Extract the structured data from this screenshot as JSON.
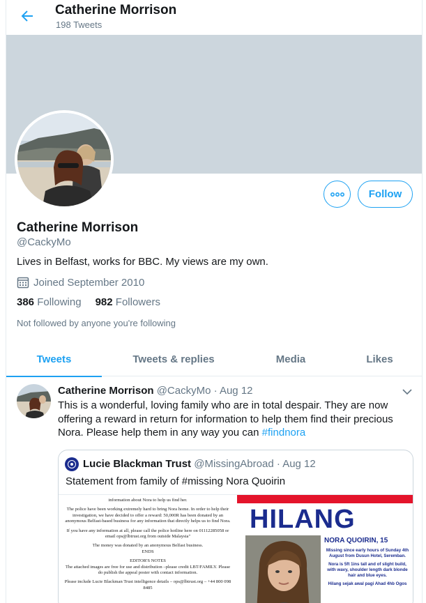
{
  "header": {
    "name": "Catherine Morrison",
    "tweet_count": "198 Tweets"
  },
  "profile": {
    "name": "Catherine Morrison",
    "handle": "@CackyMo",
    "bio": "Lives in Belfast, works for BBC. My views are my own.",
    "joined": "Joined September 2010",
    "following_count": "386",
    "following_label": "Following",
    "followers_count": "982",
    "followers_label": "Followers",
    "not_followed": "Not followed by anyone you're following",
    "follow_label": "Follow"
  },
  "tabs": [
    {
      "label": "Tweets",
      "active": true
    },
    {
      "label": "Tweets & replies",
      "active": false
    },
    {
      "label": "Media",
      "active": false
    },
    {
      "label": "Likes",
      "active": false
    }
  ],
  "tweet": {
    "author": "Catherine Morrison",
    "handle": "@CackyMo",
    "date": "· Aug 12",
    "text": "This is a wonderful, loving family who are in total despair. They are now offering a reward in return for information to help them find their precious Nora. Please help them in any way you can ",
    "hashtag": "#findnora",
    "quote": {
      "author": "Lucie Blackman Trust",
      "handle": "@MissingAbroad",
      "date": "· Aug 12",
      "text": "Statement from family of #missing Nora Quoirin",
      "document_lines": [
        "information about Nora to help us find her.",
        "The police have been working extremely hard to bring Nora home. In order to help their investigation, we have decided to offer a reward: 50,000R has been donated by an anonymous Belfast-based business for any information that directly helps us to find Nora.",
        "If you have any information at all, please call the police hotline here on 01112285058 or email ops@lbtrust.org from outside Malaysia\"",
        "The money was donated by an anonymous Belfast business.",
        "ENDS",
        "EDITOR'S NOTES",
        "The attached images are free for use and distribution –please credit LBT/FAMILY. Please do publish the appeal poster with contact information.",
        "Please include Lucie Blackman Trust intelligence details – ops@lbtrust.org – +44 800 098 8485"
      ],
      "poster_word": "HILANG",
      "poster_name": "NORA QUOIRIN, 15",
      "poster_info": [
        "Missing since early hours of Sunday 4th August from Dusun Hotel, Seremban.",
        "Nora is 5ft 1ins tall and of slight build, with wavy, shoulder length dark blonde hair and blue eyes.",
        "Hilang sejak awal pagi Ahad 4hb Ogos"
      ]
    }
  },
  "colors": {
    "accent": "#1da1f2",
    "banner": "#ccd6dd",
    "muted": "#657786",
    "poster_blue": "#1b2c8e",
    "poster_red": "#e4142b"
  },
  "icons": [
    "back-arrow-icon",
    "more-icon",
    "calendar-icon",
    "chevron-down-icon",
    "trust-logo-icon"
  ]
}
